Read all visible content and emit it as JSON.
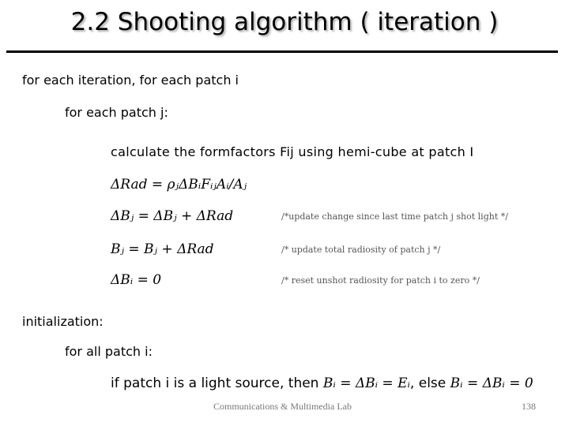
{
  "slide": {
    "title": "2.2 Shooting algorithm ( iteration )",
    "lines": {
      "loop_outer": "for each iteration, for each patch i",
      "loop_inner": "for each patch j:",
      "calc": "calculate the formfactors Fij using hemi-cube at patch I"
    },
    "equations": [
      {
        "text": "ΔRad = ρⱼΔBᵢFᵢⱼAᵢ/Aⱼ",
        "comment": ""
      },
      {
        "text": "ΔBⱼ = ΔBⱼ + ΔRad",
        "comment": "/*update change since last time patch j shot light */"
      },
      {
        "text": "Bⱼ = Bⱼ + ΔRad",
        "comment": "/* update total radiosity of patch j */"
      },
      {
        "text": "ΔBᵢ = 0",
        "comment": "/* reset unshot radiosity for patch i to zero */"
      }
    ],
    "init": {
      "label": "initialization:",
      "loop": "for all patch i:",
      "condition_prefix": "if patch i is a light source, then ",
      "condition_math1": "Bᵢ = ΔBᵢ = Eᵢ",
      "condition_mid": ", else ",
      "condition_math2": "Bᵢ = ΔBᵢ = 0"
    },
    "footer": "Communications & Multimedia Lab",
    "page_number": "138"
  }
}
